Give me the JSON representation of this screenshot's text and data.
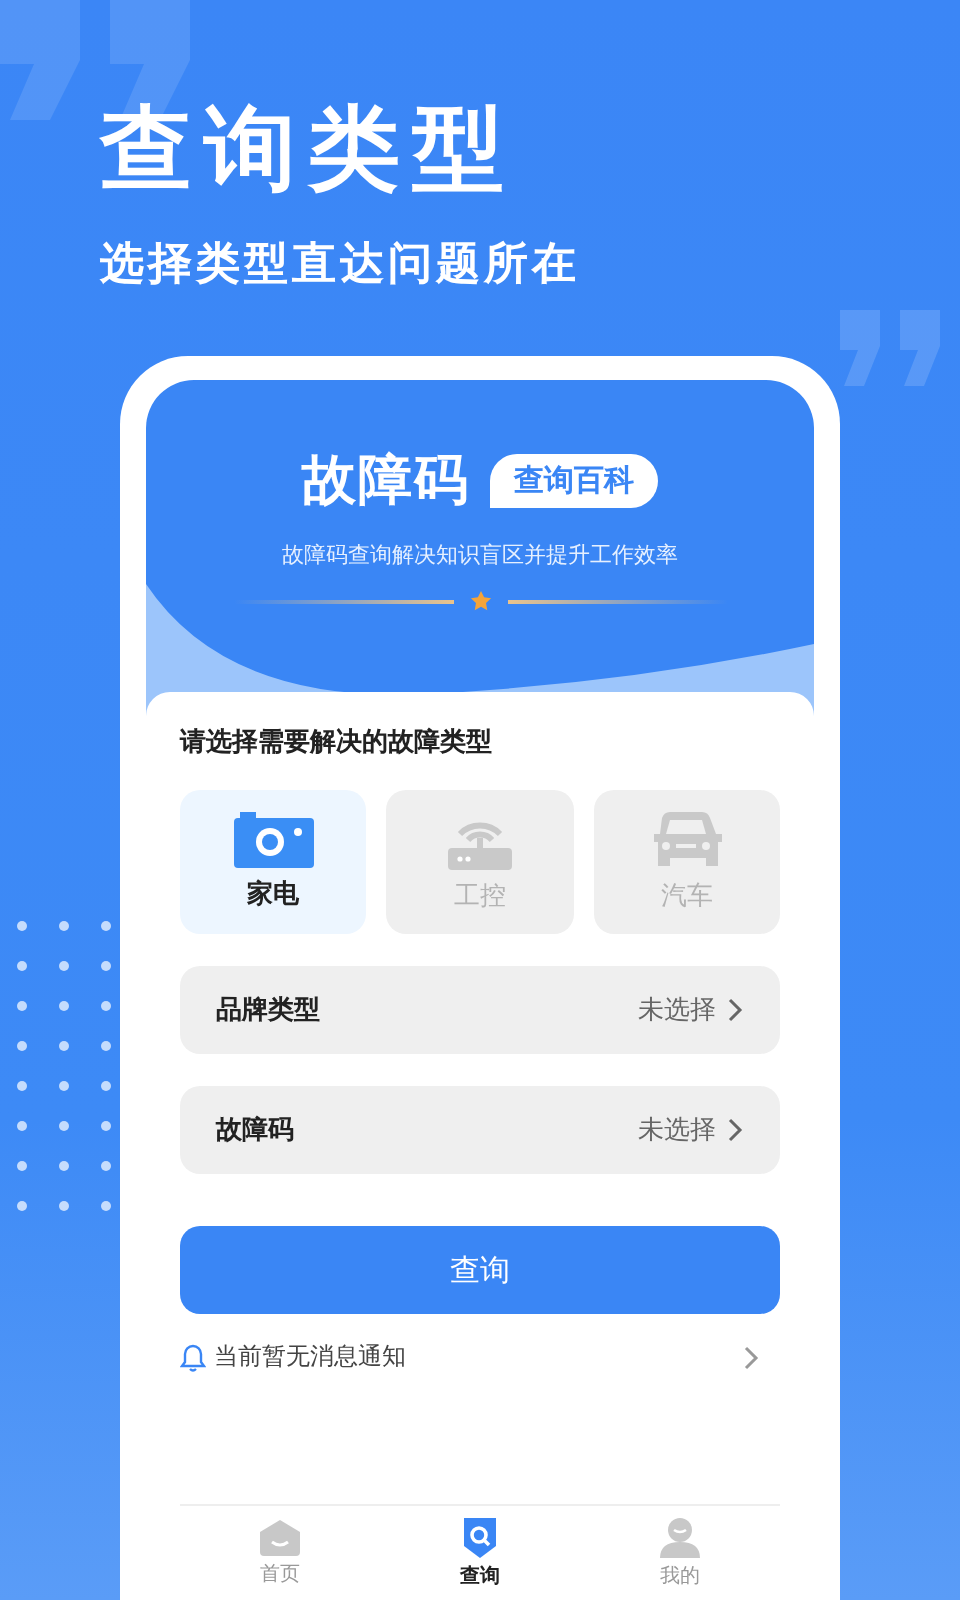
{
  "headline": "查询类型",
  "subtitle": "选择类型直达问题所在",
  "banner": {
    "title": "故障码",
    "badge": "查询百科",
    "tagline": "故障码查询解决知识盲区并提升工作效率"
  },
  "prompt": "请选择需要解决的故障类型",
  "categories": [
    {
      "kind": "camera",
      "label": "家电",
      "selected": true
    },
    {
      "kind": "router",
      "label": "工控",
      "selected": false
    },
    {
      "kind": "car",
      "label": "汽车",
      "selected": false
    }
  ],
  "rows": [
    {
      "label": "品牌类型",
      "value": "未选择"
    },
    {
      "label": "故障码",
      "value": "未选择"
    }
  ],
  "query_button": "查询",
  "notice": "当前暂无消息通知",
  "tabs": [
    {
      "kind": "home",
      "label": "首页",
      "selected": false
    },
    {
      "kind": "search",
      "label": "查询",
      "selected": true
    },
    {
      "kind": "profile",
      "label": "我的",
      "selected": false
    }
  ]
}
